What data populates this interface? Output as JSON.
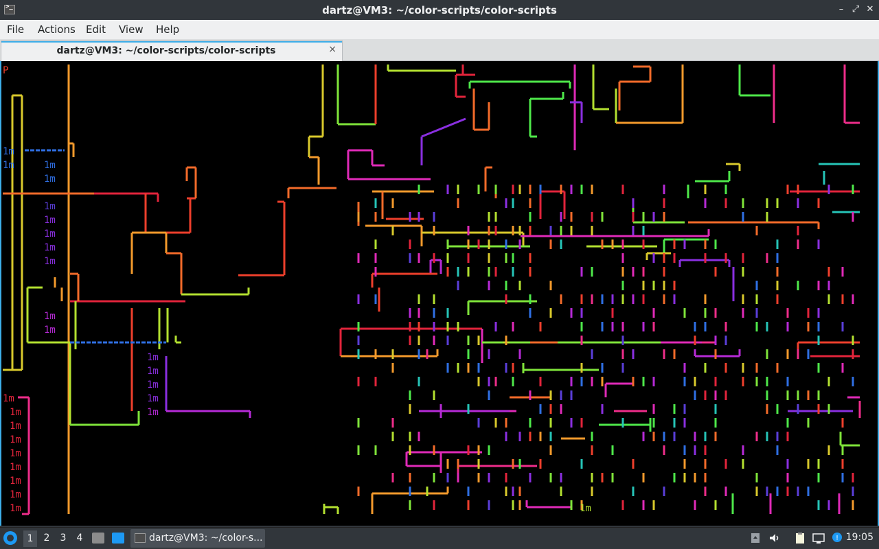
{
  "window": {
    "title": "dartz@VM3: ~/color-scripts/color-scripts",
    "controls": {
      "minimize": "–",
      "restore": "⤢",
      "close": "✕"
    }
  },
  "menu": {
    "items": [
      "File",
      "Actions",
      "Edit",
      "View",
      "Help"
    ]
  },
  "tab": {
    "label": "dartz@VM3: ~/color-scripts/color-scripts",
    "close": "×"
  },
  "terminal": {
    "content": "pipes.sh colored pipe animation",
    "prompt_fragment": "P",
    "glyph_text": "1m",
    "colors": [
      "#e2243b",
      "#ee3f2c",
      "#f36b2a",
      "#f39a2c",
      "#d9c92c",
      "#b3e030",
      "#7fe43a",
      "#4ee84a",
      "#26c4b7",
      "#2f6fe3",
      "#5a3ed8",
      "#8a2fe0",
      "#b62ad6",
      "#e02ab8",
      "#ee2d8a"
    ]
  },
  "taskbar": {
    "workspaces": [
      "1",
      "2",
      "3",
      "4"
    ],
    "active_workspace": "1",
    "task_label": "dartz@VM3: ~/color-s...",
    "clock": "19:05",
    "icons": [
      "start-menu-icon",
      "file-manager-icon",
      "show-desktop-icon",
      "terminal-icon",
      "trash-icon",
      "volume-icon",
      "clipboard-icon",
      "network-icon",
      "notification-icon"
    ]
  }
}
